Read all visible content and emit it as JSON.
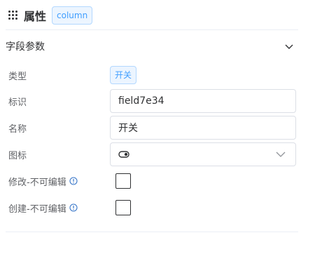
{
  "header": {
    "title": "属性",
    "tag": "column"
  },
  "section": {
    "title": "字段参数"
  },
  "fields": {
    "type": {
      "label": "类型",
      "value": "开关"
    },
    "identifier": {
      "label": "标识",
      "value": "field7e34"
    },
    "name": {
      "label": "名称",
      "value": "开关"
    },
    "icon": {
      "label": "图标",
      "value_icon": "toggle-switch-icon"
    },
    "edit_readonly": {
      "label": "修改-不可编辑",
      "checked": false
    },
    "create_readonly": {
      "label": "创建-不可编辑",
      "checked": false
    }
  },
  "colors": {
    "accent": "#409eff",
    "tag_bg": "#ecf5ff",
    "info": "#3a78c9"
  }
}
